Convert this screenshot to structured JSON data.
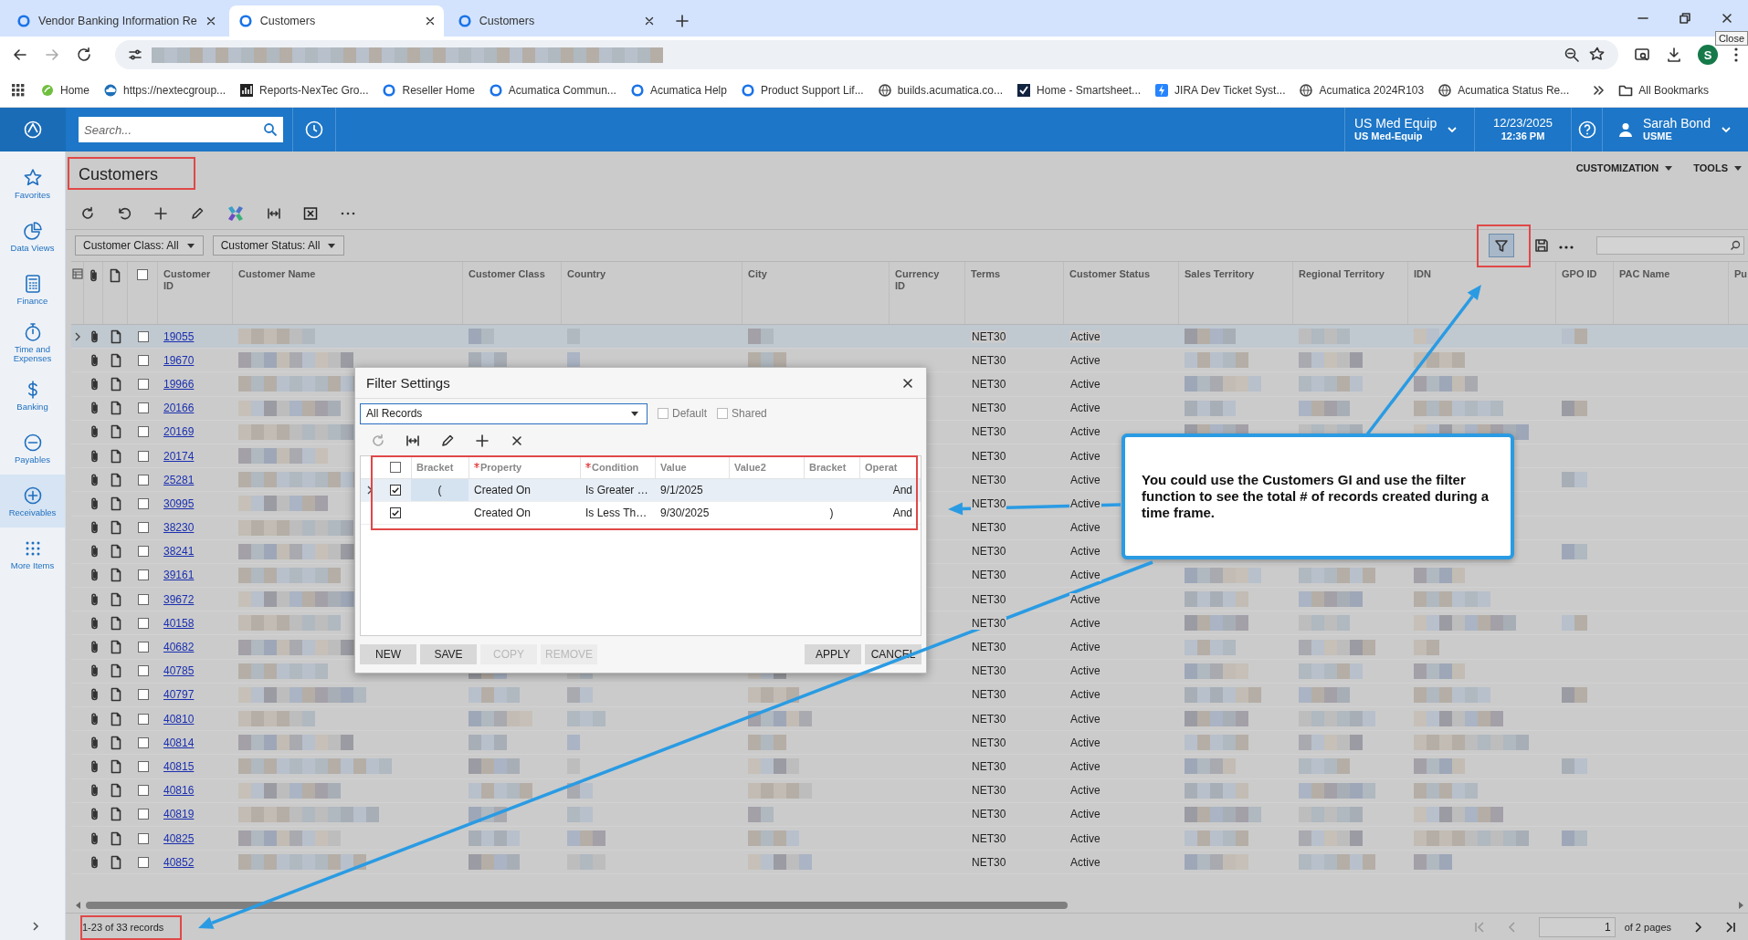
{
  "browser": {
    "tabs": [
      {
        "title": "Vendor Banking Information Re",
        "selected": false
      },
      {
        "title": "Customers",
        "selected": true
      },
      {
        "title": "Customers",
        "selected": false
      }
    ],
    "tooltip": "Close",
    "avatar_letter": "S",
    "bookmarks": [
      "Home",
      "https://nextecgroup...",
      "Reports-NexTec Gro...",
      "Reseller Home",
      "Acumatica Commun...",
      "Acumatica Help",
      "Product Support Lif...",
      "builds.acumatica.co...",
      "Home - Smartsheet...",
      "JIRA Dev Ticket Syst...",
      "Acumatica 2024R103",
      "Acumatica Status Re..."
    ],
    "all_bookmarks": "All Bookmarks"
  },
  "app_header": {
    "search": {
      "placeholder": "Search..."
    },
    "branch": "US Med Equip",
    "branch_code": "US Med-Equip",
    "date": "12/23/2025",
    "time": "12:36 PM",
    "user": "Sarah Bond",
    "user_code": "USME"
  },
  "sidebar": {
    "items": [
      {
        "label": "Favorites",
        "selected": false
      },
      {
        "label": "Data Views",
        "selected": false
      },
      {
        "label": "Finance",
        "selected": false
      },
      {
        "label": "Time and Expenses",
        "selected": false
      },
      {
        "label": "Banking",
        "selected": false
      },
      {
        "label": "Payables",
        "selected": false
      },
      {
        "label": "Receivables",
        "selected": true
      },
      {
        "label": "More Items",
        "selected": false
      }
    ]
  },
  "page": {
    "title": "Customers",
    "menus": [
      "CUSTOMIZATION",
      "TOOLS"
    ],
    "filters": [
      "Customer Class: All",
      "Customer Status: All"
    ],
    "filter_active": true
  },
  "table": {
    "select_all": false,
    "columns": [
      "Customer ID",
      "Customer Name",
      "Customer Class",
      "Country",
      "City",
      "Currency ID",
      "Terms",
      "Customer Status",
      "Sales Territory",
      "Regional Territory",
      "IDN",
      "GPO ID",
      "PAC Name",
      "Pu"
    ],
    "rows": [
      {
        "id": "19055",
        "terms": "NET30",
        "status": "Active",
        "selected": true,
        "checked": false
      },
      {
        "id": "19670",
        "terms": "NET30",
        "status": "Active",
        "selected": false,
        "checked": false
      },
      {
        "id": "19966",
        "terms": "NET30",
        "status": "Active",
        "selected": false,
        "checked": false
      },
      {
        "id": "20166",
        "terms": "NET30",
        "status": "Active",
        "selected": false,
        "checked": false
      },
      {
        "id": "20169",
        "terms": "NET30",
        "status": "Active",
        "selected": false,
        "checked": false
      },
      {
        "id": "20174",
        "terms": "NET30",
        "status": "Active",
        "selected": false,
        "checked": false
      },
      {
        "id": "25281",
        "terms": "NET30",
        "status": "Active",
        "selected": false,
        "checked": false
      },
      {
        "id": "30995",
        "terms": "NET30",
        "status": "Active",
        "selected": false,
        "checked": false
      },
      {
        "id": "38230",
        "terms": "NET30",
        "status": "Active",
        "selected": false,
        "checked": false
      },
      {
        "id": "38241",
        "terms": "NET30",
        "status": "Active",
        "selected": false,
        "checked": false
      },
      {
        "id": "39161",
        "terms": "NET30",
        "status": "Active",
        "selected": false,
        "checked": false
      },
      {
        "id": "39672",
        "terms": "NET30",
        "status": "Active",
        "selected": false,
        "checked": false
      },
      {
        "id": "40158",
        "terms": "NET30",
        "status": "Active",
        "selected": false,
        "checked": false
      },
      {
        "id": "40682",
        "terms": "NET30",
        "status": "Active",
        "selected": false,
        "checked": false
      },
      {
        "id": "40785",
        "terms": "NET30",
        "status": "Active",
        "selected": false,
        "checked": false
      },
      {
        "id": "40797",
        "terms": "NET30",
        "status": "Active",
        "selected": false,
        "checked": false
      },
      {
        "id": "40810",
        "terms": "NET30",
        "status": "Active",
        "selected": false,
        "checked": false
      },
      {
        "id": "40814",
        "terms": "NET30",
        "status": "Active",
        "selected": false,
        "checked": false
      },
      {
        "id": "40815",
        "terms": "NET30",
        "status": "Active",
        "selected": false,
        "checked": false
      },
      {
        "id": "40816",
        "terms": "NET30",
        "status": "Active",
        "selected": false,
        "checked": false
      },
      {
        "id": "40819",
        "terms": "NET30",
        "status": "Active",
        "selected": false,
        "checked": false
      },
      {
        "id": "40825",
        "terms": "NET30",
        "status": "Active",
        "selected": false,
        "checked": false
      },
      {
        "id": "40852",
        "terms": "NET30",
        "status": "Active",
        "selected": false,
        "checked": false
      }
    ]
  },
  "footer": {
    "records": "1-23 of 33 records",
    "page": "1",
    "pages": "of 2 pages"
  },
  "dialog": {
    "title": "Filter Settings",
    "view": "All Records",
    "options": [
      {
        "label": "Default",
        "checked": false,
        "disabled": true
      },
      {
        "label": "Shared",
        "checked": false,
        "disabled": true
      }
    ],
    "select_all": false,
    "columns": [
      {
        "label": "Bracket",
        "required": false
      },
      {
        "label": "Property",
        "required": true
      },
      {
        "label": "Condition",
        "required": true
      },
      {
        "label": "Value",
        "required": false
      },
      {
        "label": "Value2",
        "required": false
      },
      {
        "label": "Bracket",
        "required": false
      },
      {
        "label": "Operat",
        "required": false
      }
    ],
    "rows": [
      {
        "selected": true,
        "checked": true,
        "bracket_open": "(",
        "property": "Created On",
        "condition": "Is Greater …",
        "value": "9/1/2025",
        "operator": "And"
      },
      {
        "selected": false,
        "checked": true,
        "property": "Created On",
        "condition": "Is Less Th…",
        "value": "9/30/2025",
        "bracket_close": ")",
        "operator": "And"
      }
    ],
    "left_buttons": [
      {
        "label": "NEW",
        "disabled": false
      },
      {
        "label": "SAVE",
        "disabled": false
      },
      {
        "label": "COPY",
        "disabled": true
      },
      {
        "label": "REMOVE",
        "disabled": true
      }
    ],
    "right_buttons": [
      {
        "label": "APPLY",
        "disabled": false
      },
      {
        "label": "CANCEL",
        "disabled": false
      }
    ]
  },
  "annotation": {
    "text": "You could use the Customers GI and use the filter function to see the total # of records created during a time frame."
  }
}
